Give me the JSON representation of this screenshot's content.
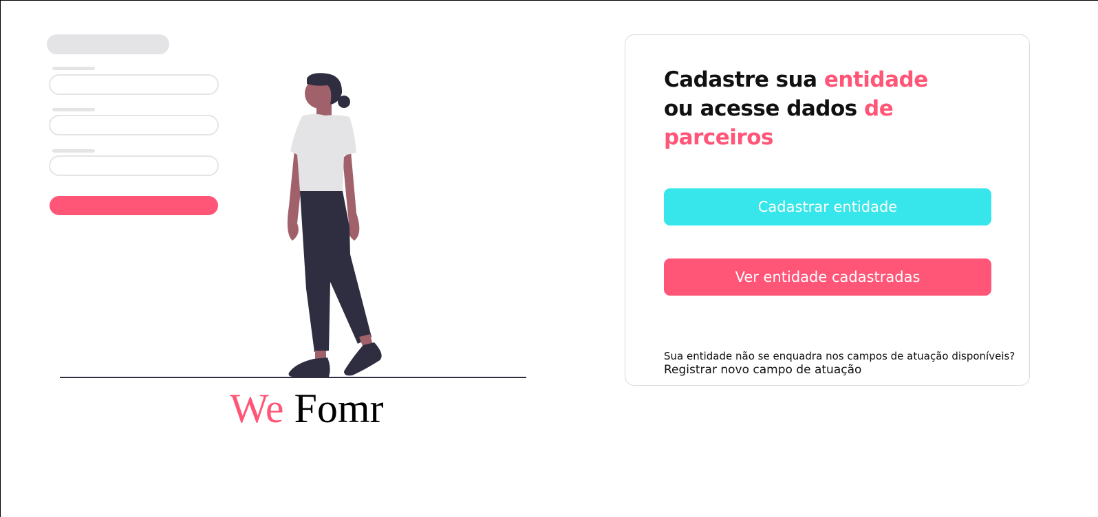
{
  "brand": {
    "first": "We",
    "second": "Fomr"
  },
  "colors": {
    "accent": "#ff5577",
    "primary_button": "#36e6ea",
    "placeholder_gray": "#e4e4e6",
    "figure_skin": "#a0616a",
    "figure_dark": "#2f2e41"
  },
  "icons": {
    "hero": "woman-with-form-illustration"
  },
  "card": {
    "title_part1": "Cadastre sua ",
    "title_accent1": "entidade",
    "title_part2": " ou acesse dados ",
    "title_accent2": "de parceiros",
    "primary_button_label": "Cadastrar entidade",
    "secondary_button_label": "Ver entidade cadastradas",
    "footer_question": "Sua entidade não se enquadra nos campos de atuação disponíveis?",
    "footer_link": "Registrar novo campo de atuação"
  }
}
